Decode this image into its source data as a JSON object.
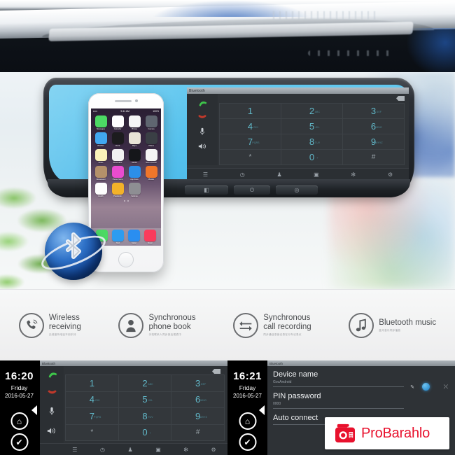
{
  "product": {
    "type": "bluetooth-rearview-mirror-dashcam",
    "mirror_display_title": "Bluetooth"
  },
  "display": {
    "title": "Bluetooth",
    "side_icons": [
      {
        "name": "answer-call-icon",
        "glyph": "answer"
      },
      {
        "name": "end-call-icon",
        "glyph": "end"
      },
      {
        "name": "microphone-icon",
        "glyph": "mic"
      },
      {
        "name": "speaker-icon",
        "glyph": "speaker"
      }
    ],
    "backspace_label": "",
    "keypad": [
      {
        "num": "1",
        "sub": ""
      },
      {
        "num": "2",
        "sub": "ABC"
      },
      {
        "num": "3",
        "sub": "DEF"
      },
      {
        "num": "4",
        "sub": "GHI"
      },
      {
        "num": "5",
        "sub": "JKL"
      },
      {
        "num": "6",
        "sub": "MNO"
      },
      {
        "num": "7",
        "sub": "PQRS"
      },
      {
        "num": "8",
        "sub": "TUV"
      },
      {
        "num": "9",
        "sub": "WXYZ"
      },
      {
        "num": "*",
        "sub": ""
      },
      {
        "num": "0",
        "sub": "+"
      },
      {
        "num": "#",
        "sub": ""
      }
    ],
    "toolbar": [
      {
        "name": "menu-icon",
        "glyph": "☰"
      },
      {
        "name": "call-history-icon",
        "glyph": "◷"
      },
      {
        "name": "contacts-icon",
        "glyph": "♟"
      },
      {
        "name": "dialpad-icon",
        "glyph": "▣"
      },
      {
        "name": "bluetooth-icon",
        "glyph": "✻"
      },
      {
        "name": "settings-icon",
        "glyph": "⚙"
      }
    ]
  },
  "mirror_buttons": [
    {
      "name": "camera-button",
      "glyph": "◧"
    },
    {
      "name": "power-button",
      "glyph": "⏻"
    },
    {
      "name": "record-button",
      "glyph": "◎"
    }
  ],
  "phone": {
    "status_carrier": "•••••",
    "status_time": "9:41 AM",
    "status_battery": "100%",
    "apps": [
      {
        "name": "Messages",
        "color": "#4cd964"
      },
      {
        "name": "Calendar",
        "color": "#ffffff"
      },
      {
        "name": "Photos",
        "color": "#f5f5f5"
      },
      {
        "name": "Camera",
        "color": "#5f6670"
      },
      {
        "name": "Weather",
        "color": "#41a7f0"
      },
      {
        "name": "Clock",
        "color": "#1c1c1e"
      },
      {
        "name": "Maps",
        "color": "#e8e3d6"
      },
      {
        "name": "Videos",
        "color": "#3a3f45"
      },
      {
        "name": "Notes",
        "color": "#fbf3b9"
      },
      {
        "name": "Reminders",
        "color": "#f2f2f2"
      },
      {
        "name": "Stocks",
        "color": "#15161a"
      },
      {
        "name": "Game Center",
        "color": "#f4f4f4"
      },
      {
        "name": "Newsstand",
        "color": "#b4916a"
      },
      {
        "name": "iTunes Store",
        "color": "#e94ccf"
      },
      {
        "name": "App Store",
        "color": "#2c8fe8"
      },
      {
        "name": "iBooks",
        "color": "#f0762a"
      },
      {
        "name": "Health",
        "color": "#fdfdfd"
      },
      {
        "name": "Passbook",
        "color": "#f3b229"
      },
      {
        "name": "Settings",
        "color": "#8e8e93"
      }
    ],
    "dock": [
      {
        "name": "Phone",
        "color": "#4cd964"
      },
      {
        "name": "Mail",
        "color": "#2d9cf0"
      },
      {
        "name": "Safari",
        "color": "#2a8ef0"
      },
      {
        "name": "Music",
        "color": "#fa3b5c"
      }
    ],
    "page_dots": 2
  },
  "features": [
    {
      "icon": "wireless-receiving-icon",
      "en_line1": "Wireless",
      "en_line2": "receiving",
      "cn": "无线接听电话不用手持"
    },
    {
      "icon": "phone-book-icon",
      "en_line1": "Synchronous",
      "en_line2": "phone book",
      "cn": "手机联系人同步到后视镜中"
    },
    {
      "icon": "call-recording-icon",
      "en_line1": "Synchronous",
      "en_line2": "call recording",
      "cn": "同步通话录音记录在行车记录仪"
    },
    {
      "icon": "bluetooth-music-icon",
      "en_line1": "Bluetooth music",
      "en_line2": "",
      "cn": "蓝牙音乐同步播放"
    }
  ],
  "bottom_left": {
    "clock": {
      "time": "16:20",
      "day": "Friday",
      "date": "2016-05-27"
    },
    "nav_buttons": [
      {
        "name": "home-button",
        "glyph": "⌂"
      },
      {
        "name": "back-button",
        "glyph": "✔"
      }
    ],
    "panel_title": "Bluetooth",
    "side_icons": [
      {
        "name": "answer-call-icon",
        "glyph": "answer"
      },
      {
        "name": "end-call-icon",
        "glyph": "end"
      },
      {
        "name": "microphone-icon",
        "glyph": "mic"
      },
      {
        "name": "speaker-icon",
        "glyph": "speaker"
      }
    ],
    "keypad": [
      {
        "num": "1",
        "sub": ""
      },
      {
        "num": "2",
        "sub": "ABC"
      },
      {
        "num": "3",
        "sub": "DEF"
      },
      {
        "num": "4",
        "sub": "GHI"
      },
      {
        "num": "5",
        "sub": "JKL"
      },
      {
        "num": "6",
        "sub": "MNO"
      },
      {
        "num": "7",
        "sub": "PQRS"
      },
      {
        "num": "8",
        "sub": "TUV"
      },
      {
        "num": "9",
        "sub": "WXYZ"
      },
      {
        "num": "*",
        "sub": ""
      },
      {
        "num": "0",
        "sub": "+"
      },
      {
        "num": "#",
        "sub": ""
      }
    ],
    "toolbar": [
      {
        "name": "menu-icon",
        "glyph": "☰"
      },
      {
        "name": "call-history-icon",
        "glyph": "◷"
      },
      {
        "name": "contacts-icon",
        "glyph": "♟"
      },
      {
        "name": "dialpad-icon",
        "glyph": "▣"
      },
      {
        "name": "bluetooth-icon",
        "glyph": "✻"
      },
      {
        "name": "settings-icon",
        "glyph": "⚙"
      }
    ]
  },
  "bottom_right": {
    "clock": {
      "time": "16:21",
      "day": "Friday",
      "date": "2016-05-27"
    },
    "nav_buttons": [
      {
        "name": "home-button",
        "glyph": "⌂"
      },
      {
        "name": "back-button",
        "glyph": "✔"
      }
    ],
    "panel_title": "Bluetooth",
    "settings": [
      {
        "label": "Device name",
        "value": "GocAndroid"
      },
      {
        "label": "PIN password",
        "value": "0000"
      },
      {
        "label": "Auto connect",
        "value": ""
      }
    ],
    "edit_icon": "pencil-icon",
    "toggle_on": true
  },
  "watermark": {
    "text": "ProBarahlo",
    "icon": "camera-icon",
    "color": "#e8112d"
  }
}
